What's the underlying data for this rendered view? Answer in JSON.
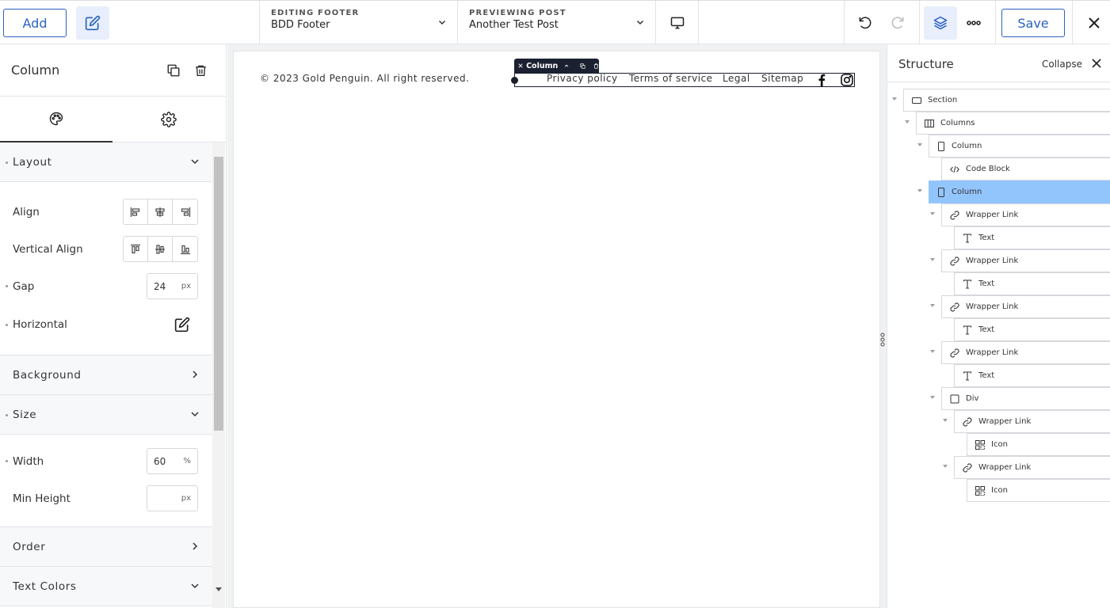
{
  "topbar": {
    "add_label": "Add",
    "editing": {
      "label": "EDITING FOOTER",
      "value": "BDD Footer"
    },
    "previewing": {
      "label": "PREVIEWING POST",
      "value": "Another Test Post"
    },
    "save_label": "Save",
    "accent_color": "#2a62c4"
  },
  "left_panel": {
    "title": "Column",
    "sections": {
      "layout": "Layout",
      "background": "Background",
      "size": "Size",
      "order": "Order",
      "text_colors": "Text Colors"
    },
    "layout": {
      "align_label": "Align",
      "valign_label": "Vertical Align",
      "gap_label": "Gap",
      "gap_value": "24",
      "gap_unit": "px",
      "horizontal_label": "Horizontal"
    },
    "size": {
      "width_label": "Width",
      "width_value": "60",
      "width_unit": "%",
      "minheight_label": "Min Height",
      "minheight_value": "",
      "minheight_unit": "px"
    }
  },
  "canvas": {
    "copyright": "© 2023 Gold Penguin. All right reserved.",
    "column_badge": "Column",
    "links": [
      "Privacy policy",
      "Terms of service",
      "Legal",
      "Sitemap"
    ]
  },
  "structure": {
    "title": "Structure",
    "collapse_label": "Collapse",
    "selected_color": "#93c5fd",
    "nodes": [
      {
        "label": "Section",
        "icon": "section-icon"
      },
      {
        "label": "Columns",
        "icon": "columns-icon"
      },
      {
        "label": "Column",
        "icon": "column-icon"
      },
      {
        "label": "Code Block",
        "icon": "code-icon"
      },
      {
        "label": "Column",
        "icon": "column-icon",
        "selected": true
      },
      {
        "label": "Wrapper Link",
        "icon": "link-icon"
      },
      {
        "label": "Text",
        "icon": "text-icon"
      },
      {
        "label": "Wrapper Link",
        "icon": "link-icon"
      },
      {
        "label": "Text",
        "icon": "text-icon"
      },
      {
        "label": "Wrapper Link",
        "icon": "link-icon"
      },
      {
        "label": "Text",
        "icon": "text-icon"
      },
      {
        "label": "Wrapper Link",
        "icon": "link-icon"
      },
      {
        "label": "Text",
        "icon": "text-icon"
      },
      {
        "label": "Div",
        "icon": "div-icon"
      },
      {
        "label": "Wrapper Link",
        "icon": "link-icon"
      },
      {
        "label": "Icon",
        "icon": "icon-element-icon"
      },
      {
        "label": "Wrapper Link",
        "icon": "link-icon"
      },
      {
        "label": "Icon",
        "icon": "icon-element-icon"
      }
    ]
  }
}
